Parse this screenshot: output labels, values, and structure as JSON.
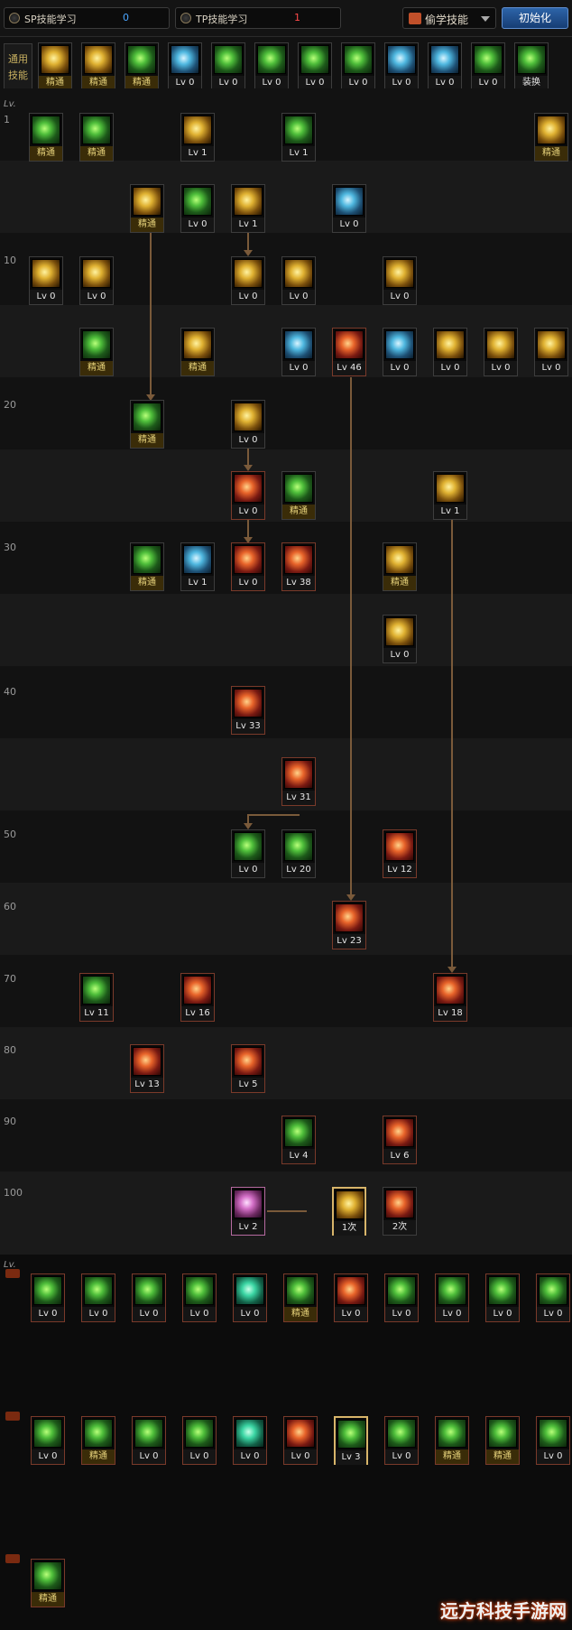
{
  "tabs": {
    "sp_label": "SP技能学习",
    "sp_value": "0",
    "tp_label": "TP技能学习",
    "tp_value": "1",
    "steal_label": "偷学技能",
    "init_label": "初始化"
  },
  "common": {
    "label": "通用技能",
    "swap_label": "装换",
    "slots": [
      {
        "text": "精通",
        "color": "gold"
      },
      {
        "text": "精通",
        "color": "gold"
      },
      {
        "text": "精通",
        "color": "green"
      },
      {
        "text": "Lv 0",
        "color": "blue"
      },
      {
        "text": "Lv 0",
        "color": "green"
      },
      {
        "text": "Lv 0",
        "color": "green"
      },
      {
        "text": "Lv 0",
        "color": "green"
      },
      {
        "text": "Lv 0",
        "color": "green"
      },
      {
        "text": "Lv 0",
        "color": "blue"
      },
      {
        "text": "Lv 0",
        "color": "blue"
      },
      {
        "text": "Lv 0",
        "color": "green"
      },
      {
        "text": "装换",
        "color": "green"
      }
    ]
  },
  "lv_header": "Lv.",
  "level_labels": [
    "1",
    "10",
    "20",
    "30",
    "40",
    "50",
    "60",
    "70",
    "80",
    "90",
    "100"
  ],
  "lv_header_bottom": "Lv.",
  "skills": [
    {
      "col": 1,
      "row": 0,
      "text": "精通",
      "color": "green",
      "mastered": true
    },
    {
      "col": 2,
      "row": 0,
      "text": "精通",
      "color": "green",
      "mastered": true
    },
    {
      "col": 4,
      "row": 0,
      "text": "Lv 1",
      "color": "gold"
    },
    {
      "col": 6,
      "row": 0,
      "text": "Lv 1",
      "color": "green"
    },
    {
      "col": 11,
      "row": 0,
      "text": "精通",
      "color": "gold",
      "mastered": true
    },
    {
      "col": 3,
      "row": 1,
      "text": "精通",
      "color": "gold",
      "mastered": true
    },
    {
      "col": 4,
      "row": 1,
      "text": "Lv 0",
      "color": "green"
    },
    {
      "col": 5,
      "row": 1,
      "text": "Lv 1",
      "color": "gold"
    },
    {
      "col": 7,
      "row": 1,
      "text": "Lv 0",
      "color": "blue"
    },
    {
      "col": 1,
      "row": 2,
      "text": "Lv 0",
      "color": "gold"
    },
    {
      "col": 2,
      "row": 2,
      "text": "Lv 0",
      "color": "gold"
    },
    {
      "col": 5,
      "row": 2,
      "text": "Lv 0",
      "color": "gold"
    },
    {
      "col": 6,
      "row": 2,
      "text": "Lv 0",
      "color": "gold"
    },
    {
      "col": 8,
      "row": 2,
      "text": "Lv 0",
      "color": "gold"
    },
    {
      "col": 2,
      "row": 3,
      "text": "精通",
      "color": "green",
      "mastered": true
    },
    {
      "col": 4,
      "row": 3,
      "text": "精通",
      "color": "gold",
      "mastered": true
    },
    {
      "col": 6,
      "row": 3,
      "text": "Lv 0",
      "color": "blue"
    },
    {
      "col": 7,
      "row": 3,
      "text": "Lv 46",
      "color": "red",
      "up": true
    },
    {
      "col": 8,
      "row": 3,
      "text": "Lv 0",
      "color": "blue"
    },
    {
      "col": 9,
      "row": 3,
      "text": "Lv 0",
      "color": "gold"
    },
    {
      "col": 10,
      "row": 3,
      "text": "Lv 0",
      "color": "gold"
    },
    {
      "col": 11,
      "row": 3,
      "text": "Lv 0",
      "color": "gold"
    },
    {
      "col": 3,
      "row": 4,
      "text": "精通",
      "color": "green",
      "mastered": true
    },
    {
      "col": 5,
      "row": 4,
      "text": "Lv 0",
      "color": "gold"
    },
    {
      "col": 5,
      "row": 5,
      "text": "Lv 0",
      "color": "red",
      "up": true
    },
    {
      "col": 6,
      "row": 5,
      "text": "精通",
      "color": "green",
      "mastered": true
    },
    {
      "col": 9,
      "row": 5,
      "text": "Lv 1",
      "color": "gold"
    },
    {
      "col": 3,
      "row": 6,
      "text": "精通",
      "color": "green",
      "mastered": true
    },
    {
      "col": 4,
      "row": 6,
      "text": "Lv 1",
      "color": "blue"
    },
    {
      "col": 5,
      "row": 6,
      "text": "Lv 0",
      "color": "red",
      "up": true
    },
    {
      "col": 6,
      "row": 6,
      "text": "Lv 38",
      "color": "red",
      "up": true
    },
    {
      "col": 8,
      "row": 6,
      "text": "精通",
      "color": "gold",
      "mastered": true
    },
    {
      "col": 8,
      "row": 7,
      "text": "Lv 0",
      "color": "gold"
    },
    {
      "col": 5,
      "row": 8,
      "text": "Lv 33",
      "color": "red",
      "up": true
    },
    {
      "col": 6,
      "row": 9,
      "text": "Lv 31",
      "color": "red",
      "up": true
    },
    {
      "col": 5,
      "row": 10,
      "text": "Lv 0",
      "color": "green"
    },
    {
      "col": 6,
      "row": 10,
      "text": "Lv 20",
      "color": "green"
    },
    {
      "col": 8,
      "row": 10,
      "text": "Lv 12",
      "color": "red",
      "up": true
    },
    {
      "col": 7,
      "row": 11,
      "text": "Lv 23",
      "color": "red",
      "up": true
    },
    {
      "col": 2,
      "row": 12,
      "text": "Lv 11",
      "color": "green",
      "up": true
    },
    {
      "col": 4,
      "row": 12,
      "text": "Lv 16",
      "color": "red",
      "up": true
    },
    {
      "col": 9,
      "row": 12,
      "text": "Lv 18",
      "color": "red",
      "up": true
    },
    {
      "col": 3,
      "row": 13,
      "text": "Lv 13",
      "color": "red",
      "up": true
    },
    {
      "col": 5,
      "row": 13,
      "text": "Lv 5",
      "color": "red",
      "up": true
    },
    {
      "col": 6,
      "row": 14,
      "text": "Lv 4",
      "color": "green",
      "up": true
    },
    {
      "col": 8,
      "row": 14,
      "text": "Lv 6",
      "color": "red",
      "up": true
    },
    {
      "col": 5,
      "row": 15,
      "text": "Lv 2",
      "color": "pinkc",
      "pink": true
    },
    {
      "col": 7,
      "row": 15,
      "text": "1次",
      "color": "gold",
      "sel": true
    },
    {
      "col": 8,
      "row": 15,
      "text": "2次",
      "color": "red"
    }
  ],
  "tp_rows": [
    {
      "tag": "TP",
      "slots": [
        {
          "text": "Lv 0",
          "color": "green"
        },
        {
          "text": "Lv 0",
          "color": "green"
        },
        {
          "text": "Lv 0",
          "color": "green"
        },
        {
          "text": "Lv 0",
          "color": "green"
        },
        {
          "text": "Lv 0",
          "color": "teal"
        },
        {
          "text": "精通",
          "color": "green"
        },
        {
          "text": "Lv 0",
          "color": "red"
        },
        {
          "text": "Lv 0",
          "color": "green"
        },
        {
          "text": "Lv 0",
          "color": "green"
        },
        {
          "text": "Lv 0",
          "color": "green"
        },
        {
          "text": "Lv 0",
          "color": "green"
        }
      ]
    },
    {
      "tag": "TP",
      "slots": [
        {
          "text": "Lv 0",
          "color": "green"
        },
        {
          "text": "精通",
          "color": "green"
        },
        {
          "text": "Lv 0",
          "color": "green"
        },
        {
          "text": "Lv 0",
          "color": "green"
        },
        {
          "text": "Lv 0",
          "color": "teal"
        },
        {
          "text": "Lv 0",
          "color": "red"
        },
        {
          "text": "Lv 3",
          "color": "green",
          "sel": true
        },
        {
          "text": "Lv 0",
          "color": "green"
        },
        {
          "text": "精通",
          "color": "green"
        },
        {
          "text": "精通",
          "color": "green"
        },
        {
          "text": "Lv 0",
          "color": "green"
        }
      ]
    },
    {
      "tag": "TP",
      "slots": [
        {
          "text": "精通",
          "color": "green"
        }
      ]
    }
  ],
  "watermark": "远方科技手游网"
}
